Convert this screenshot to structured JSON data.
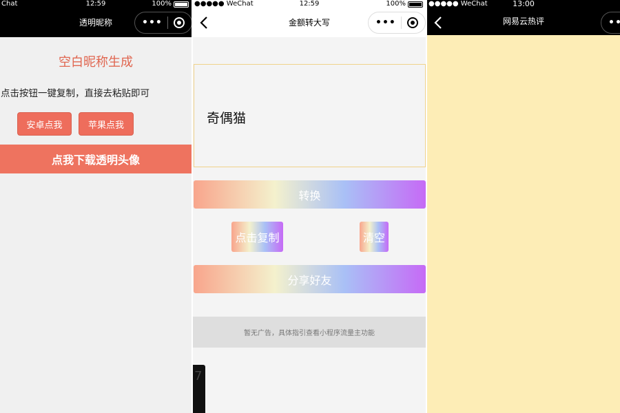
{
  "panel1": {
    "status": {
      "carrier": "Chat",
      "time": "12:59",
      "battery": "100%"
    },
    "nav_title": "透明昵称",
    "heading": "空白昵称生成",
    "hint": "点击按钮一键复制，直接去粘贴即可",
    "android_button": "安卓点我",
    "apple_button": "苹果点我",
    "download_button": "点我下载透明头像",
    "colors": {
      "accent": "#ee6d5c",
      "heading": "#e06650"
    }
  },
  "panel2": {
    "status": {
      "carrier": "●●●●● WeChat",
      "time": "12:59",
      "battery": "100%"
    },
    "nav_title": "金额转大写",
    "input_text": "奇偶猫",
    "convert_button": "转换",
    "copy_button": "点击复制",
    "clear_button": "清空",
    "share_button": "分享好友",
    "ad_text": "暂无广告，具体指引查看小程序流量主功能",
    "partial_glyph": "7"
  },
  "panel3": {
    "status": {
      "carrier": "●●●●● WeChat",
      "time": "13:00"
    },
    "nav_title": "网易云热评",
    "colors": {
      "background": "#fdedb6"
    }
  }
}
